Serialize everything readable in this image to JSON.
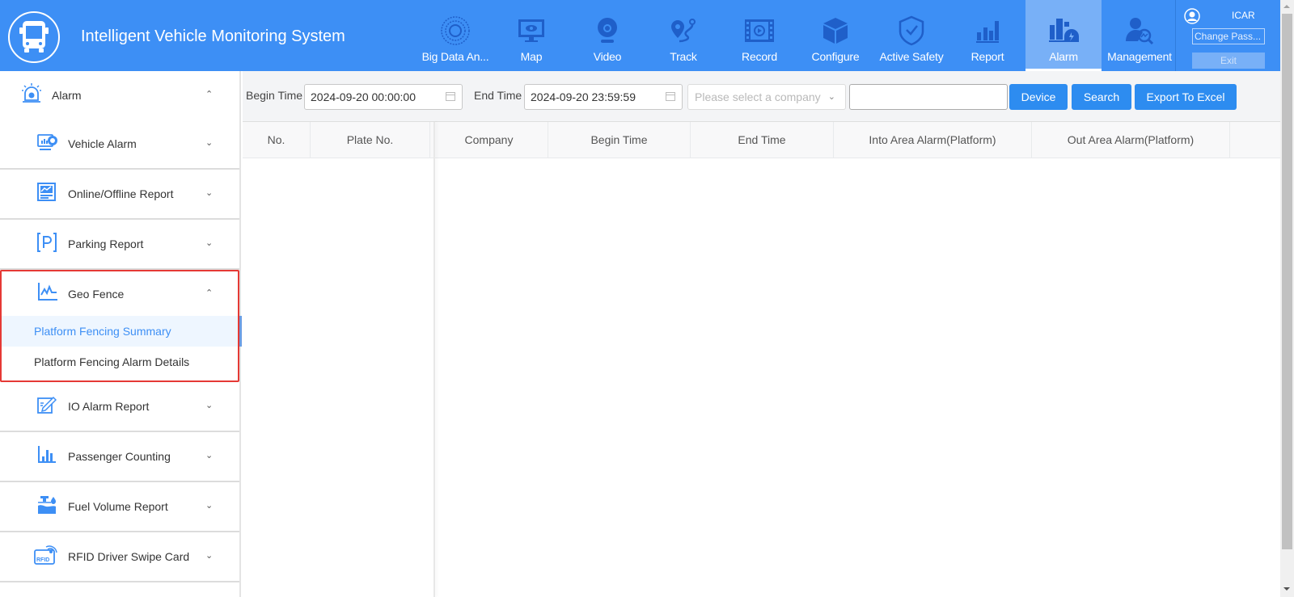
{
  "header": {
    "app_title": "Intelligent Vehicle Monitoring System",
    "nav": [
      {
        "label": "Big Data An...",
        "icon": "big-data-icon",
        "active": false
      },
      {
        "label": "Map",
        "icon": "map-monitor-icon",
        "active": false
      },
      {
        "label": "Video",
        "icon": "webcam-icon",
        "active": false
      },
      {
        "label": "Track",
        "icon": "track-route-icon",
        "active": false
      },
      {
        "label": "Record",
        "icon": "record-film-icon",
        "active": false
      },
      {
        "label": "Configure",
        "icon": "cube-icon",
        "active": false
      },
      {
        "label": "Active Safety",
        "icon": "shield-check-icon",
        "active": false
      },
      {
        "label": "Report",
        "icon": "bar-chart-icon",
        "active": false
      },
      {
        "label": "Alarm",
        "icon": "alarm-siren-icon",
        "active": true
      },
      {
        "label": "Management",
        "icon": "user-search-icon",
        "active": false
      }
    ],
    "user": {
      "name": "ICAR",
      "change_password_label": "Change Pass...",
      "exit_label": "Exit"
    }
  },
  "sidebar": {
    "top": {
      "label": "Alarm",
      "icon": "alarm-siren-icon",
      "expanded": true
    },
    "items": [
      {
        "label": "Vehicle Alarm",
        "icon": "monitor-alarm-icon",
        "expanded": false
      },
      {
        "label": "Online/Offline Report",
        "icon": "report-chart-icon",
        "expanded": false
      },
      {
        "label": "Parking Report",
        "icon": "parking-icon",
        "expanded": false
      }
    ],
    "geo_fence": {
      "label": "Geo Fence",
      "icon": "line-chart-icon",
      "expanded": true,
      "children": [
        {
          "label": "Platform Fencing Summary",
          "active": true
        },
        {
          "label": "Platform Fencing Alarm Details",
          "active": false
        }
      ]
    },
    "items_after": [
      {
        "label": "IO Alarm Report",
        "icon": "edit-doc-icon",
        "expanded": false
      },
      {
        "label": "Passenger Counting",
        "icon": "bar-stats-icon",
        "expanded": false
      },
      {
        "label": "Fuel Volume Report",
        "icon": "fuel-icon",
        "expanded": false
      },
      {
        "label": "RFID Driver Swipe Card",
        "icon": "rfid-icon",
        "expanded": false
      }
    ]
  },
  "toolbar": {
    "begin_time_label": "Begin Time",
    "begin_time_value": "2024-09-20 00:00:00",
    "end_time_label": "End Time",
    "end_time_value": "2024-09-20 23:59:59",
    "company_placeholder": "Please select a company",
    "search_text_value": "",
    "device_button": "Device",
    "search_button": "Search",
    "export_button": "Export To Excel"
  },
  "table": {
    "columns": [
      "No.",
      "Plate No.",
      "Company",
      "Begin Time",
      "End Time",
      "Into Area Alarm(Platform)",
      "Out Area Alarm(Platform)"
    ],
    "rows": []
  },
  "colors": {
    "header_bg": "#3d8ff5",
    "active_nav_bg": "#78b0f7",
    "button_primary": "#2d8cf0",
    "highlight_border": "#e53935",
    "active_sub_text": "#3d8ff5"
  }
}
